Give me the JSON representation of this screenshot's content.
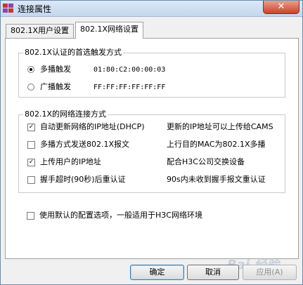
{
  "window": {
    "title": "连接属性",
    "close_label": "✕"
  },
  "tabs": [
    {
      "label": "802.1X用户设置"
    },
    {
      "label": "802.1X网络设置"
    }
  ],
  "trigger_group": {
    "title": "802.1X认证的首选触发方式",
    "options": [
      {
        "label": "多播触发",
        "value": "01:80:C2:00:00:03",
        "selected": true
      },
      {
        "label": "广播触发",
        "value": "FF:FF:FF:FF:FF:FF",
        "selected": false
      }
    ]
  },
  "network_group": {
    "title": "802.1X的网络连接方式",
    "items": [
      {
        "label": "自动更新网络的IP地址(DHCP)",
        "description": "更新的IP地址可以上传给CAMS",
        "checked": true
      },
      {
        "label": "多播方式发送802.1X报文",
        "description": "上行目的MAC为802.1X多播",
        "checked": false
      },
      {
        "label": "上传用户的IP地址",
        "description": "配合H3C公司交换设备",
        "checked": true
      },
      {
        "label": "握手超时(90秒)后重认证",
        "description": "90s内未收到握手报文重认证",
        "checked": false
      }
    ]
  },
  "default_option": {
    "label": "使用默认的配置选项，一般适用于H3C网络环境",
    "checked": false
  },
  "buttons": {
    "ok": "确定",
    "cancel": "取消",
    "apply": "应用(A)"
  },
  "watermark": "Bai 经验",
  "check_mark": "✓"
}
